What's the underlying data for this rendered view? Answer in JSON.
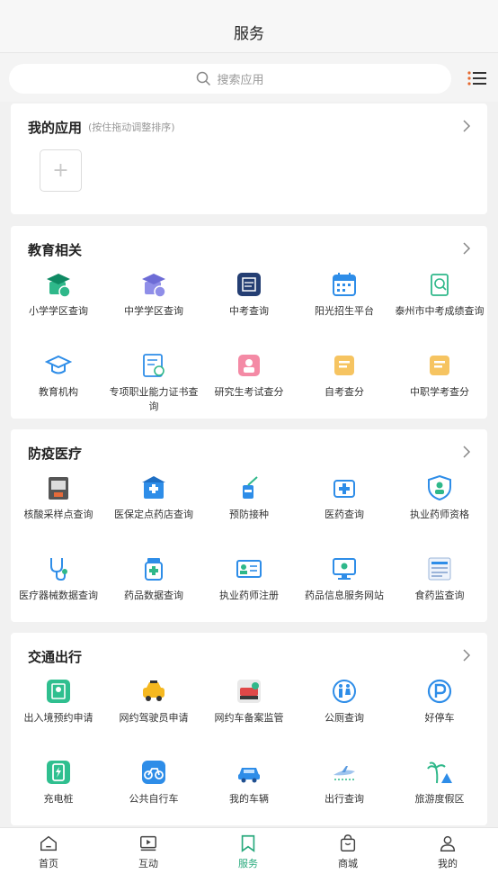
{
  "header": {
    "title": "服务"
  },
  "search": {
    "placeholder": "搜索应用"
  },
  "my_apps": {
    "title": "我的应用",
    "hint": "(按住拖动调整排序)",
    "add_symbol": "+"
  },
  "sections": [
    {
      "title": "教育相关",
      "items": [
        {
          "label": "小学学区查询",
          "icon": "school-cap-green-icon"
        },
        {
          "label": "中学学区查询",
          "icon": "school-cap-purple-icon"
        },
        {
          "label": "中考查询",
          "icon": "exam-doc-icon"
        },
        {
          "label": "阳光招生平台",
          "icon": "calendar-icon"
        },
        {
          "label": "泰州市中考成绩查询",
          "icon": "score-search-icon"
        },
        {
          "label": "教育机构",
          "icon": "graduation-cap-icon"
        },
        {
          "label": "专项职业能力证书查询",
          "icon": "certificate-icon"
        },
        {
          "label": "研究生考试查分",
          "icon": "graduate-exam-icon"
        },
        {
          "label": "自考查分",
          "icon": "self-exam-icon"
        },
        {
          "label": "中职学考查分",
          "icon": "vocational-exam-icon"
        }
      ]
    },
    {
      "title": "防疫医疗",
      "items": [
        {
          "label": "核酸采样点查询",
          "icon": "nucleic-test-icon"
        },
        {
          "label": "医保定点药店查询",
          "icon": "pharmacy-icon"
        },
        {
          "label": "预防接种",
          "icon": "vaccine-icon"
        },
        {
          "label": "医药查询",
          "icon": "medicine-kit-icon"
        },
        {
          "label": "执业药师资格",
          "icon": "pharmacist-shield-icon"
        },
        {
          "label": "医疗器械数据查询",
          "icon": "stethoscope-icon"
        },
        {
          "label": "药品数据查询",
          "icon": "medicine-bottle-icon"
        },
        {
          "label": "执业药师注册",
          "icon": "id-card-icon"
        },
        {
          "label": "药品信息服务网站",
          "icon": "monitor-icon"
        },
        {
          "label": "食药监查询",
          "icon": "food-drug-icon"
        }
      ]
    },
    {
      "title": "交通出行",
      "items": [
        {
          "label": "出入境预约申请",
          "icon": "passport-icon"
        },
        {
          "label": "网约驾驶员申请",
          "icon": "taxi-icon"
        },
        {
          "label": "网约车备案监管",
          "icon": "car-registry-icon"
        },
        {
          "label": "公厕查询",
          "icon": "restroom-icon"
        },
        {
          "label": "好停车",
          "icon": "parking-icon"
        },
        {
          "label": "充电桩",
          "icon": "charging-pile-icon"
        },
        {
          "label": "公共自行车",
          "icon": "bicycle-icon"
        },
        {
          "label": "我的车辆",
          "icon": "my-car-icon"
        },
        {
          "label": "出行查询",
          "icon": "airplane-icon"
        },
        {
          "label": "旅游度假区",
          "icon": "palm-tree-icon"
        }
      ]
    }
  ],
  "bottom_nav": [
    {
      "label": "首页",
      "icon": "home-icon"
    },
    {
      "label": "互动",
      "icon": "video-icon"
    },
    {
      "label": "服务",
      "icon": "bookmark-icon",
      "active": true
    },
    {
      "label": "商城",
      "icon": "shopping-bag-icon"
    },
    {
      "label": "我的",
      "icon": "profile-icon"
    }
  ],
  "colors": {
    "accent": "#27a97c",
    "text": "#333333",
    "background": "#f1f1f1"
  }
}
